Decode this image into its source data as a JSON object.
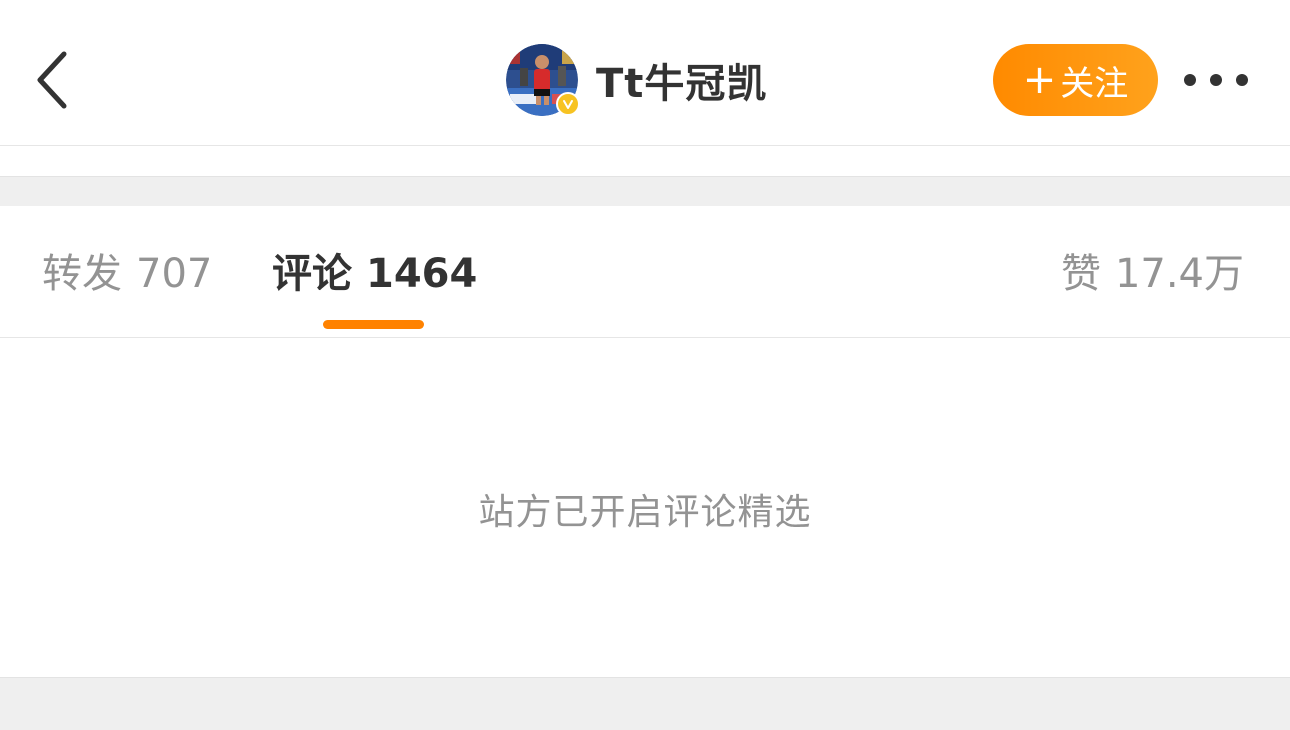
{
  "header": {
    "username": "Tt牛冠凯",
    "follow_plus": "+",
    "follow_label": "关注",
    "back_icon": "chevron-left-icon",
    "more_icon": "more-horizontal-icon"
  },
  "tabs": {
    "repost": {
      "label": "转发",
      "count": "707"
    },
    "comments": {
      "label": "评论",
      "count": "1464",
      "active": true
    },
    "likes": {
      "label": "赞",
      "count": "17.4万"
    }
  },
  "content": {
    "notice": "站方已开启评论精选"
  },
  "colors": {
    "accent": "#ff8200",
    "follow_gradient_start": "#ff8a00",
    "follow_gradient_end": "#ffa21c",
    "verified_badge": "#f7c322",
    "text_primary": "#333333",
    "text_secondary": "#939393",
    "separator": "#efefef"
  }
}
